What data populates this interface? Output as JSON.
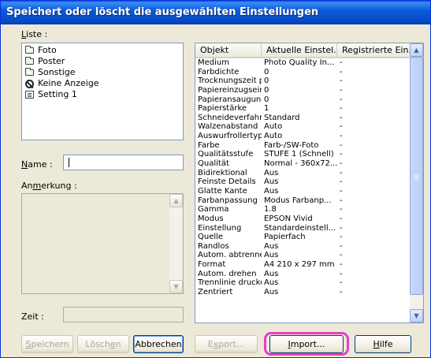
{
  "window": {
    "title": "Speichert oder löscht die ausgewählten Einstellungen"
  },
  "list": {
    "label_prefix": "",
    "label_mnemonic": "L",
    "label_rest": "iste :",
    "items": [
      {
        "label": "Foto",
        "icon": "folder-icon"
      },
      {
        "label": "Poster",
        "icon": "folder-icon"
      },
      {
        "label": "Sonstige",
        "icon": "folder-icon"
      },
      {
        "label": "Keine Anzeige",
        "icon": "no-entry-icon"
      },
      {
        "label": "Setting 1",
        "icon": "settings-document-icon"
      }
    ]
  },
  "name_field": {
    "label_mnemonic": "N",
    "label_rest": "ame :",
    "value": ""
  },
  "comment_field": {
    "label_prefix": "An",
    "label_mnemonic": "m",
    "label_rest": "erkung :",
    "value": ""
  },
  "time_field": {
    "label": "Zeit :",
    "value": ""
  },
  "table": {
    "headers": [
      "Objekt",
      "Aktuelle Einstel...",
      "Registrierte Ein..."
    ],
    "rows": [
      [
        "Medium",
        "Photo Quality In...",
        "-"
      ],
      [
        "Farbdichte",
        "0",
        "-"
      ],
      [
        "Trocknungszeit p...",
        "0",
        "-"
      ],
      [
        "Papiereinzugsein...",
        "0",
        "-"
      ],
      [
        "Papieransaugung",
        "0",
        "-"
      ],
      [
        "Papierstärke",
        "1",
        "-"
      ],
      [
        "Schneideverfahren",
        "Standard",
        "-"
      ],
      [
        "Walzenabstand",
        "Auto",
        "-"
      ],
      [
        "Auswurfrollertyp",
        "Auto",
        "-"
      ],
      [
        "Farbe",
        "Farb-/SW-Foto",
        "-"
      ],
      [
        "Qualitätsstufe",
        "STUFE 1 (Schnell)",
        "-"
      ],
      [
        "Qualität",
        "Normal - 360x72...",
        "-"
      ],
      [
        "Bidirektional",
        "Aus",
        "-"
      ],
      [
        "Feinste Details",
        "Aus",
        "-"
      ],
      [
        "Glatte Kante",
        "Aus",
        "-"
      ],
      [
        "Farbanpassung",
        "Modus Farbanp...",
        "-"
      ],
      [
        "Gamma",
        "1.8",
        "-"
      ],
      [
        "Modus",
        "EPSON Vivid",
        "-"
      ],
      [
        "Einstellung",
        "Standardeinstell...",
        "-"
      ],
      [
        "Quelle",
        "Papierfach",
        "-"
      ],
      [
        "Randlos",
        "Aus",
        "-"
      ],
      [
        "Autom. abtrennen",
        "Aus",
        "-"
      ],
      [
        "Format",
        "A4 210 x 297 mm",
        "-"
      ],
      [
        "Autom. drehen",
        "Aus",
        "-"
      ],
      [
        "Trennlinie drucken",
        "Aus",
        "-"
      ],
      [
        "Zentriert",
        "Aus",
        "-"
      ]
    ]
  },
  "buttons": {
    "save": {
      "mnemonic": "S",
      "rest": "peichern"
    },
    "delete": {
      "prefix": "Lösch",
      "mnemonic": "e",
      "rest": "n"
    },
    "cancel": "Abbrechen",
    "export": {
      "prefix": "E",
      "mnemonic": "x",
      "rest": "port..."
    },
    "import": {
      "mnemonic": "I",
      "rest": "mport..."
    },
    "help": {
      "mnemonic": "H",
      "rest": "ilfe"
    }
  },
  "colors": {
    "titlebar": "#0a5bd8",
    "dialog_face": "#ece9d8",
    "highlight_ring": "#e63ec8"
  }
}
